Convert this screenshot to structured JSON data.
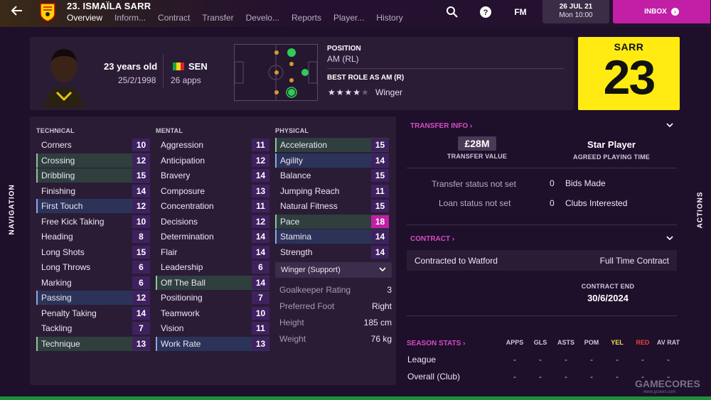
{
  "header": {
    "player_title": "23. ISMAÏLA SARR",
    "tabs": [
      "Overview",
      "Inform...",
      "Contract",
      "Transfer",
      "Develo...",
      "Reports",
      "Player...",
      "History"
    ],
    "fm_label": "FM",
    "date_line1": "26 JUL 21",
    "date_line2": "Mon 10:00",
    "inbox_label": "INBOX"
  },
  "player": {
    "age": "23 years old",
    "dob": "25/2/1998",
    "nation": "SEN",
    "apps": "26 apps",
    "position_label": "POSITION",
    "position_value": "AM (RL)",
    "best_role_label": "BEST ROLE AS AM (R)",
    "best_role_value": "Winger",
    "role_stars": 4,
    "shirt_name": "SARR",
    "shirt_number": "23"
  },
  "attributes": {
    "technical_title": "TECHNICAL",
    "mental_title": "MENTAL",
    "physical_title": "PHYSICAL",
    "technical": [
      {
        "name": "Corners",
        "value": "10"
      },
      {
        "name": "Crossing",
        "value": "12"
      },
      {
        "name": "Dribbling",
        "value": "15"
      },
      {
        "name": "Finishing",
        "value": "14"
      },
      {
        "name": "First Touch",
        "value": "12"
      },
      {
        "name": "Free Kick Taking",
        "value": "10"
      },
      {
        "name": "Heading",
        "value": "8"
      },
      {
        "name": "Long Shots",
        "value": "15"
      },
      {
        "name": "Long Throws",
        "value": "6"
      },
      {
        "name": "Marking",
        "value": "6"
      },
      {
        "name": "Passing",
        "value": "12"
      },
      {
        "name": "Penalty Taking",
        "value": "14"
      },
      {
        "name": "Tackling",
        "value": "7"
      },
      {
        "name": "Technique",
        "value": "13"
      }
    ],
    "mental": [
      {
        "name": "Aggression",
        "value": "11"
      },
      {
        "name": "Anticipation",
        "value": "12"
      },
      {
        "name": "Bravery",
        "value": "14"
      },
      {
        "name": "Composure",
        "value": "13"
      },
      {
        "name": "Concentration",
        "value": "11"
      },
      {
        "name": "Decisions",
        "value": "12"
      },
      {
        "name": "Determination",
        "value": "14"
      },
      {
        "name": "Flair",
        "value": "14"
      },
      {
        "name": "Leadership",
        "value": "6"
      },
      {
        "name": "Off The Ball",
        "value": "14"
      },
      {
        "name": "Positioning",
        "value": "7"
      },
      {
        "name": "Teamwork",
        "value": "10"
      },
      {
        "name": "Vision",
        "value": "11"
      },
      {
        "name": "Work Rate",
        "value": "13"
      }
    ],
    "physical": [
      {
        "name": "Acceleration",
        "value": "15"
      },
      {
        "name": "Agility",
        "value": "14"
      },
      {
        "name": "Balance",
        "value": "15"
      },
      {
        "name": "Jumping Reach",
        "value": "11"
      },
      {
        "name": "Natural Fitness",
        "value": "15"
      },
      {
        "name": "Pace",
        "value": "18"
      },
      {
        "name": "Stamina",
        "value": "14"
      },
      {
        "name": "Strength",
        "value": "14"
      }
    ],
    "role_select": "Winger (Support)",
    "extra": [
      {
        "label": "Goalkeeper Rating",
        "value": "3"
      },
      {
        "label": "Preferred Foot",
        "value": "Right"
      },
      {
        "label": "Height",
        "value": "185 cm"
      },
      {
        "label": "Weight",
        "value": "76 kg"
      }
    ]
  },
  "transfer": {
    "title": "TRANSFER INFO",
    "value": "£28M",
    "value_label": "TRANSFER VALUE",
    "playing_time": "Star Player",
    "playing_time_label": "AGREED PLAYING TIME",
    "status": "Transfer status not set",
    "bids_count": "0",
    "bids_label": "Bids Made",
    "loan_status": "Loan status not set",
    "clubs_count": "0",
    "clubs_label": "Clubs Interested"
  },
  "contract": {
    "title": "CONTRACT",
    "club": "Contracted to Watford",
    "type": "Full Time Contract",
    "end_label": "CONTRACT END",
    "end_date": "30/6/2024"
  },
  "season_stats": {
    "title": "SEASON STATS",
    "columns": [
      "APPS",
      "GLS",
      "ASTS",
      "POM",
      "YEL",
      "RED",
      "AV RAT"
    ],
    "rows": [
      {
        "name": "League",
        "values": [
          "-",
          "-",
          "-",
          "-",
          "-",
          "-",
          "-"
        ]
      },
      {
        "name": "Overall (Club)",
        "values": [
          "-",
          "-",
          "-",
          "-",
          "-",
          "-",
          "-"
        ]
      }
    ]
  },
  "side": {
    "navigation": "NAVIGATION",
    "actions": "ACTIONS"
  },
  "watermark": {
    "text": "GAMECORES",
    "sub": "www.gcores.com"
  },
  "colors": {
    "accent": "#c21fa6",
    "shirt": "#ffeb12",
    "value_box": "#3f2160",
    "pitch_green": "#2ecc55",
    "pitch_orange": "#d49a2a"
  }
}
